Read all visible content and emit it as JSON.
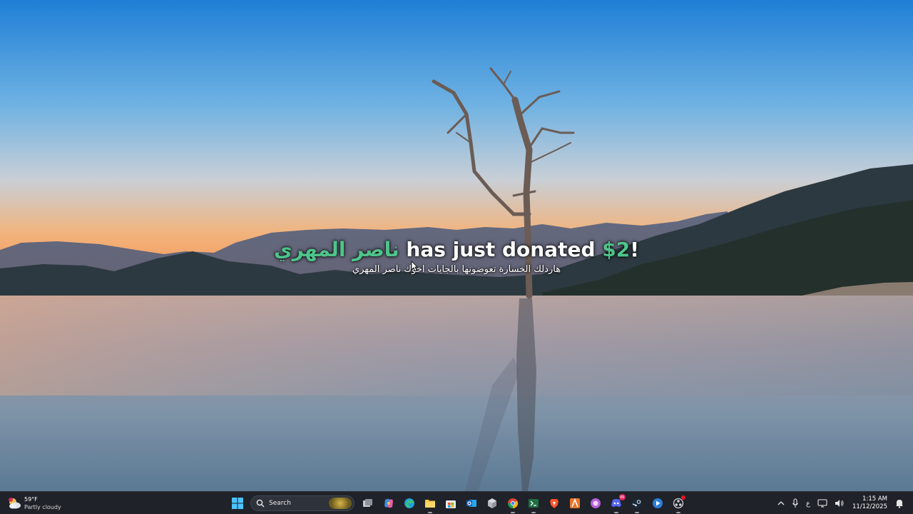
{
  "donation": {
    "donor": "ناصر المهري",
    "middle": " has just donated ",
    "amount": "$2",
    "end": "!",
    "message": "هاردلك الخسارة تعوضونها بالجايات اخوك ناصر المهري"
  },
  "taskbar": {
    "weather": {
      "temp": "59°F",
      "condition": "Partly cloudy",
      "icon": "partly-cloudy-icon"
    },
    "search_label": "Search",
    "apps": [
      {
        "name": "windows-start-icon"
      },
      {
        "name": "task-view-icon"
      },
      {
        "name": "copilot-icon"
      },
      {
        "name": "edge-icon"
      },
      {
        "name": "file-explorer-icon"
      },
      {
        "name": "microsoft-store-icon"
      },
      {
        "name": "outlook-icon"
      },
      {
        "name": "cube-app-icon"
      },
      {
        "name": "chrome-icon"
      },
      {
        "name": "terminal-icon"
      },
      {
        "name": "brave-icon"
      },
      {
        "name": "affinity-icon"
      },
      {
        "name": "pink-app-icon"
      },
      {
        "name": "discord-icon",
        "badge": "99"
      },
      {
        "name": "steam-icon"
      },
      {
        "name": "media-player-icon"
      },
      {
        "name": "obs-icon"
      }
    ],
    "tray": {
      "ime_label": "ع",
      "time": "1:15 AM",
      "date": "11/12/2025"
    }
  },
  "colors": {
    "accent_green": "#4ec48a",
    "taskbar_bg": "#1f2228"
  }
}
